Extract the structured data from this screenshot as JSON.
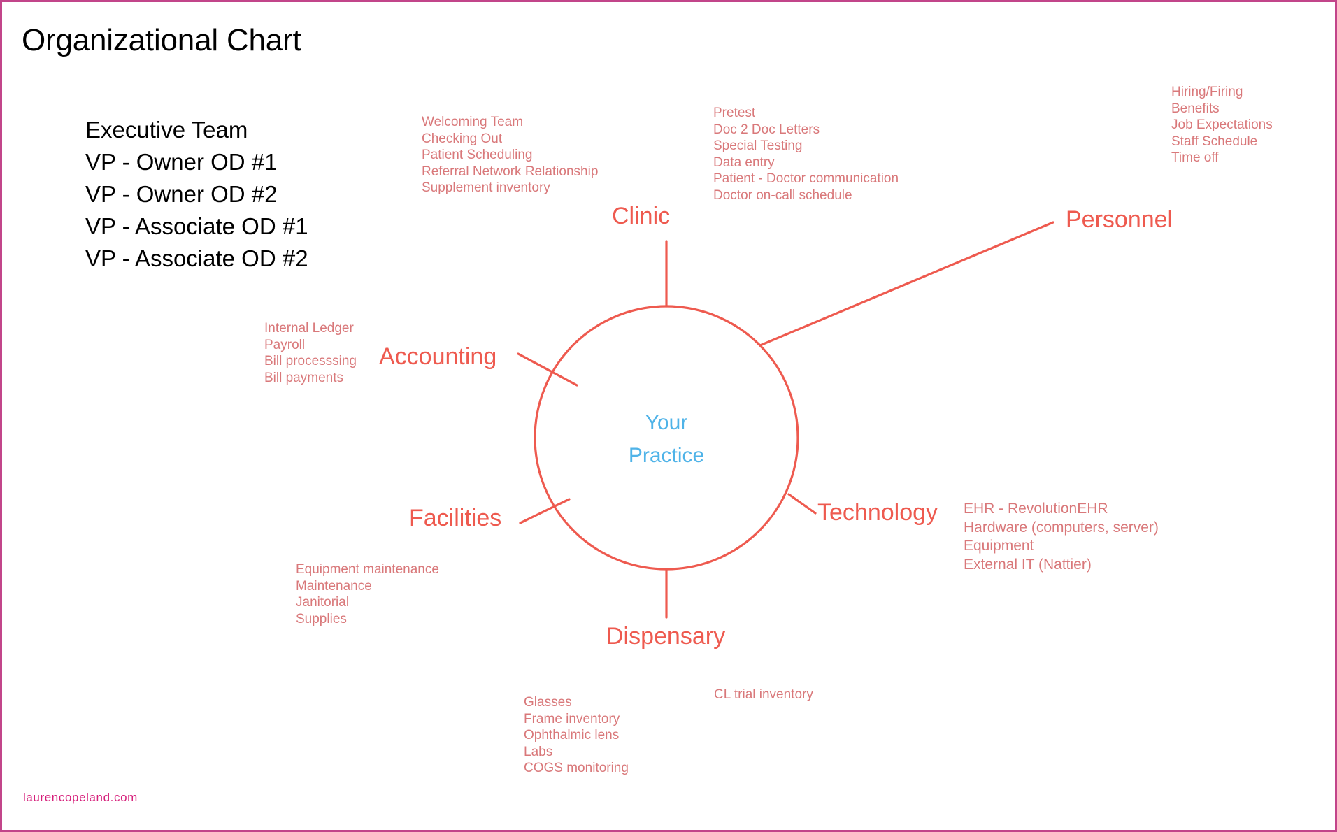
{
  "page": {
    "title": "Organizational Chart",
    "border_color": "#c2458a",
    "background": "#ffffff"
  },
  "colors": {
    "branch_label": "#ee5a4f",
    "detail_text": "#d9787a",
    "center_text": "#4fb3e8",
    "spoke_line": "#ee5a4f",
    "title_text": "#000000",
    "footer_text": "#d61e7a"
  },
  "executive": {
    "heading": "Executive Team",
    "members": [
      "VP - Owner OD #1",
      "VP - Owner OD #2",
      "VP - Associate OD #1",
      "VP - Associate OD #2"
    ]
  },
  "hub": {
    "center_line_1": "Your",
    "center_line_2": "Practice"
  },
  "branches": {
    "clinic": {
      "label": "Clinic",
      "items_primary": [
        "Welcoming Team",
        "Checking Out",
        "Patient Scheduling",
        "Referral Network Relationship",
        "Supplement inventory"
      ],
      "items_secondary": [
        "Pretest",
        "Doc 2 Doc Letters",
        "Special Testing",
        "Data entry",
        "Patient - Doctor communication",
        "Doctor on-call schedule"
      ]
    },
    "personnel": {
      "label": "Personnel",
      "items": [
        "Hiring/Firing",
        "Benefits",
        "Job Expectations",
        "Staff Schedule",
        "Time off"
      ]
    },
    "accounting": {
      "label": "Accounting",
      "items": [
        "Internal Ledger",
        "Payroll",
        "Bill processsing",
        "Bill payments"
      ]
    },
    "facilities": {
      "label": "Facilities",
      "items": [
        "Equipment maintenance",
        "Maintenance",
        "Janitorial",
        "Supplies"
      ]
    },
    "technology": {
      "label": "Technology",
      "items": [
        "EHR - RevolutionEHR",
        "Hardware (computers, server)",
        "Equipment",
        "External IT (Nattier)"
      ]
    },
    "dispensary": {
      "label": "Dispensary",
      "items_primary": [
        "Glasses",
        "Frame inventory",
        "Ophthalmic lens",
        "Labs",
        "COGS monitoring"
      ],
      "items_secondary": [
        "CL trial inventory"
      ]
    }
  },
  "footer": {
    "watermark": "laurencopeland.com"
  },
  "chart_data": {
    "type": "diagram",
    "diagram_kind": "hub-and-spoke organizational chart",
    "title": "Organizational Chart",
    "hub": "Your Practice",
    "spokes": [
      {
        "name": "Clinic",
        "direction": "top",
        "items": [
          "Welcoming Team",
          "Checking Out",
          "Patient Scheduling",
          "Referral Network Relationship",
          "Supplement inventory",
          "Pretest",
          "Doc 2 Doc Letters",
          "Special Testing",
          "Data entry",
          "Patient - Doctor communication",
          "Doctor on-call schedule"
        ]
      },
      {
        "name": "Personnel",
        "direction": "upper-right",
        "items": [
          "Hiring/Firing",
          "Benefits",
          "Job Expectations",
          "Staff Schedule",
          "Time off"
        ]
      },
      {
        "name": "Technology",
        "direction": "lower-right",
        "items": [
          "EHR - RevolutionEHR",
          "Hardware (computers, server)",
          "Equipment",
          "External IT (Nattier)"
        ]
      },
      {
        "name": "Dispensary",
        "direction": "bottom",
        "items": [
          "Glasses",
          "Frame inventory",
          "Ophthalmic lens",
          "Labs",
          "COGS monitoring",
          "CL trial inventory"
        ]
      },
      {
        "name": "Facilities",
        "direction": "lower-left",
        "items": [
          "Equipment maintenance",
          "Maintenance",
          "Janitorial",
          "Supplies"
        ]
      },
      {
        "name": "Accounting",
        "direction": "upper-left",
        "items": [
          "Internal Ledger",
          "Payroll",
          "Bill processsing",
          "Bill payments"
        ]
      }
    ],
    "side_panel": {
      "heading": "Executive Team",
      "entries": [
        "VP - Owner OD #1",
        "VP - Owner OD #2",
        "VP - Associate OD #1",
        "VP - Associate OD #2"
      ]
    }
  }
}
